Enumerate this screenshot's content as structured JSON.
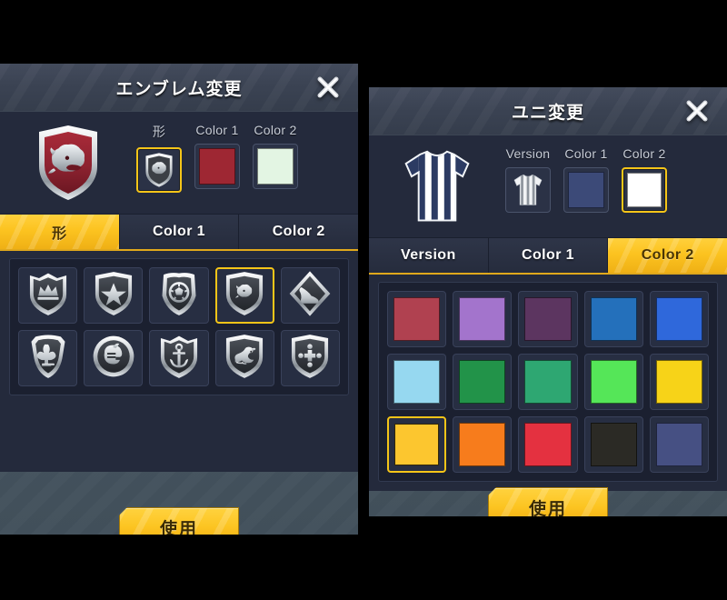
{
  "left_panel": {
    "title": "エンブレム変更",
    "close_icon": "close-icon",
    "preview": {
      "emblem_name": "lion-shield-emblem",
      "color1": "#9e2733",
      "color2": "#e3f5e3"
    },
    "attributes": [
      {
        "label": "形",
        "type": "shape",
        "value": "lion-shield-emblem",
        "selected": true
      },
      {
        "label": "Color 1",
        "type": "color",
        "value": "#9e2733",
        "selected": false
      },
      {
        "label": "Color 2",
        "type": "color",
        "value": "#e3f5e3",
        "selected": false
      }
    ],
    "tabs": [
      {
        "label": "形",
        "active": true
      },
      {
        "label": "Color 1",
        "active": false
      },
      {
        "label": "Color 2",
        "active": false
      }
    ],
    "shapes": [
      {
        "name": "crown-shield-emblem",
        "selected": false
      },
      {
        "name": "star-shield-emblem",
        "selected": false
      },
      {
        "name": "soccerball-shield-emblem",
        "selected": false
      },
      {
        "name": "lion-shield-emblem",
        "selected": true
      },
      {
        "name": "boot-diamond-emblem",
        "selected": false
      },
      {
        "name": "fleur-de-lis-shield-emblem",
        "selected": false
      },
      {
        "name": "knight-helmet-circle-emblem",
        "selected": false
      },
      {
        "name": "anchor-shield-emblem",
        "selected": false
      },
      {
        "name": "dragon-shield-emblem",
        "selected": false
      },
      {
        "name": "cross-shield-emblem",
        "selected": false
      }
    ],
    "use_button": "使用"
  },
  "right_panel": {
    "title": "ユニ変更",
    "close_icon": "close-icon",
    "preview": {
      "jersey_name": "striped-jersey",
      "color1": "#3c4a78",
      "color2": "#ffffff"
    },
    "attributes": [
      {
        "label": "Version",
        "type": "jersey",
        "value": "striped-jersey",
        "selected": false
      },
      {
        "label": "Color 1",
        "type": "color",
        "value": "#3c4a78",
        "selected": false
      },
      {
        "label": "Color 2",
        "type": "color",
        "value": "#ffffff",
        "selected": true
      }
    ],
    "tabs": [
      {
        "label": "Version",
        "active": false
      },
      {
        "label": "Color 1",
        "active": false
      },
      {
        "label": "Color 2",
        "active": true
      }
    ],
    "colors": [
      {
        "hex": "#b04150",
        "selected": false
      },
      {
        "hex": "#a374cc",
        "selected": false
      },
      {
        "hex": "#5c3560",
        "selected": false
      },
      {
        "hex": "#2470bb",
        "selected": false
      },
      {
        "hex": "#2f68db",
        "selected": false
      },
      {
        "hex": "#96d8f0",
        "selected": false
      },
      {
        "hex": "#229349",
        "selected": false
      },
      {
        "hex": "#2ea772",
        "selected": false
      },
      {
        "hex": "#55e658",
        "selected": false
      },
      {
        "hex": "#f7d318",
        "selected": false
      },
      {
        "hex": "#fcc62f",
        "selected": true
      },
      {
        "hex": "#f77c1c",
        "selected": false
      },
      {
        "hex": "#e43140",
        "selected": false
      },
      {
        "hex": "#2b2a25",
        "selected": false
      },
      {
        "hex": "#465083",
        "selected": false
      }
    ],
    "use_button": "使用"
  }
}
